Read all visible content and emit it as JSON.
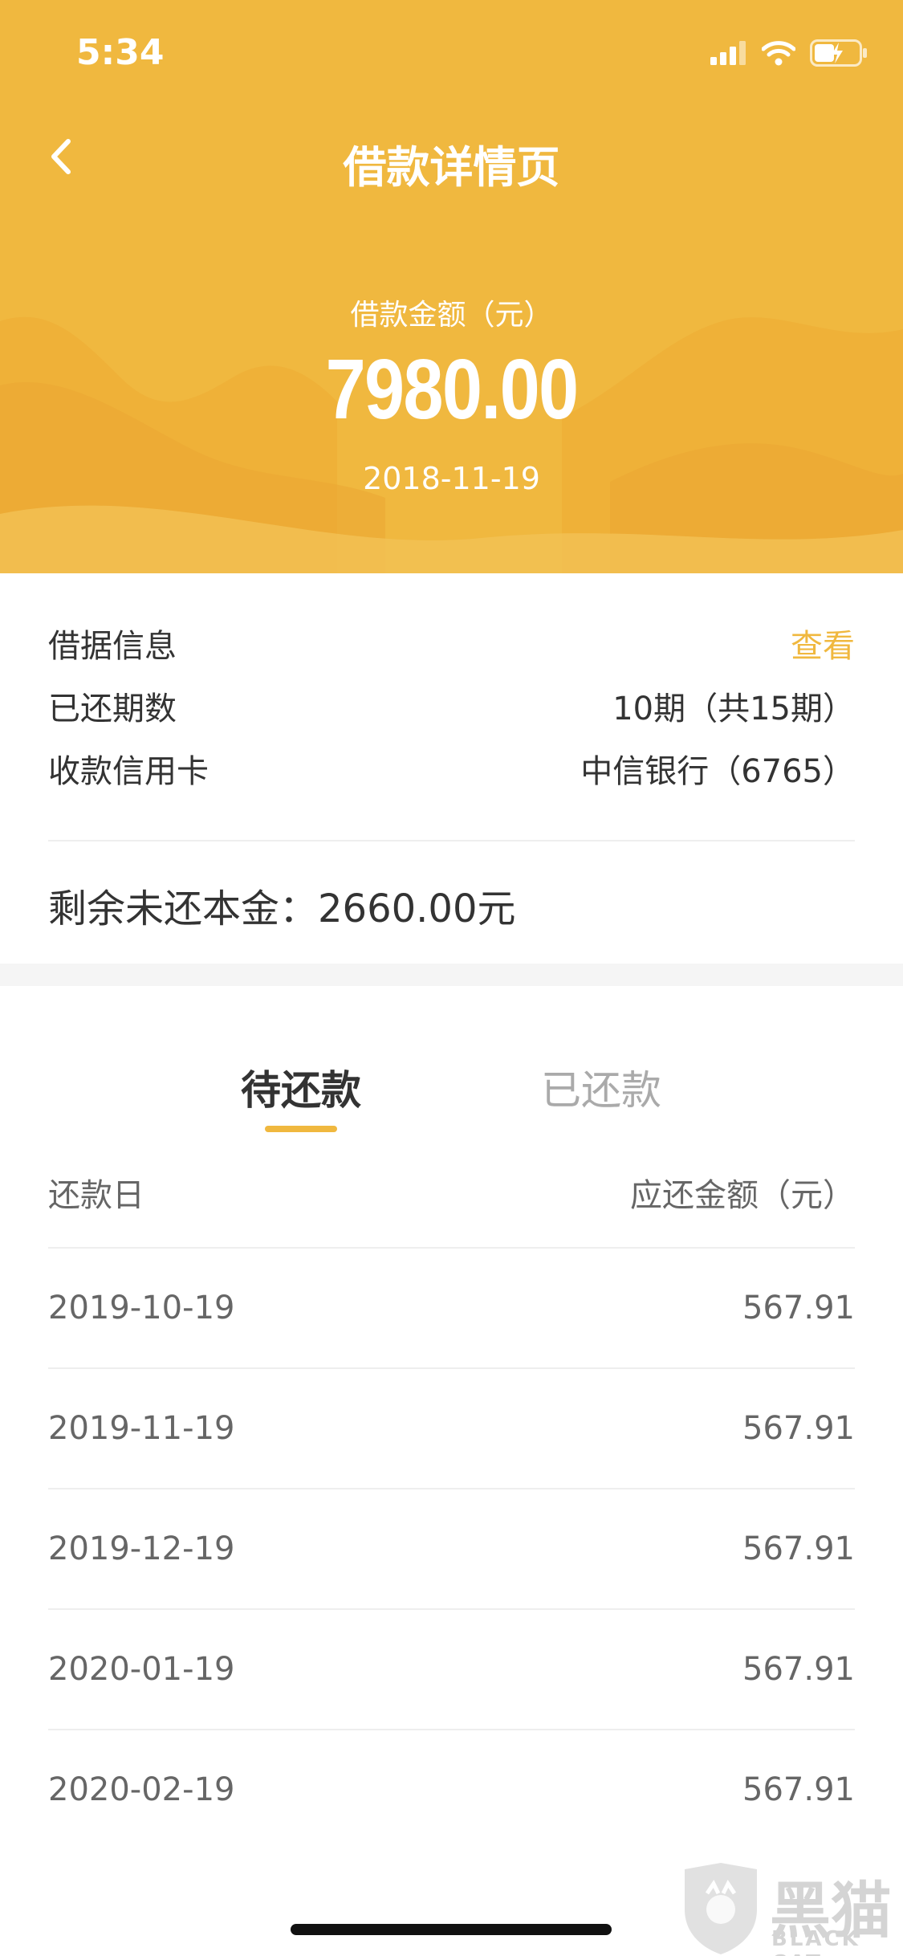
{
  "status_bar": {
    "time": "5:34",
    "icons": [
      "signal-icon",
      "wifi-icon",
      "battery-charging-icon"
    ]
  },
  "nav": {
    "title": "借款详情页",
    "back_icon": "chevron-left-icon"
  },
  "header": {
    "amount_label": "借款金额（元）",
    "amount": "7980.00",
    "date": "2018-11-19",
    "color": "#f0b83f"
  },
  "info": {
    "rows": [
      {
        "label": "借据信息",
        "value": "查看"
      },
      {
        "label": "已还期数",
        "value": "10期（共15期）"
      },
      {
        "label": "收款信用卡",
        "value": "中信银行（6765）"
      }
    ],
    "remaining": "剩余未还本金：2660.00元"
  },
  "tabs": {
    "items": [
      "待还款",
      "已还款"
    ],
    "active_index": 0
  },
  "table": {
    "headers": [
      "还款日",
      "应还金额（元）"
    ],
    "rows": [
      {
        "date": "2019-10-19",
        "amount": "567.91"
      },
      {
        "date": "2019-11-19",
        "amount": "567.91"
      },
      {
        "date": "2019-12-19",
        "amount": "567.91"
      },
      {
        "date": "2020-01-19",
        "amount": "567.91"
      },
      {
        "date": "2020-02-19",
        "amount": "567.91"
      }
    ]
  },
  "watermark": {
    "cn": "黑猫",
    "en": "BLACK CAT"
  }
}
